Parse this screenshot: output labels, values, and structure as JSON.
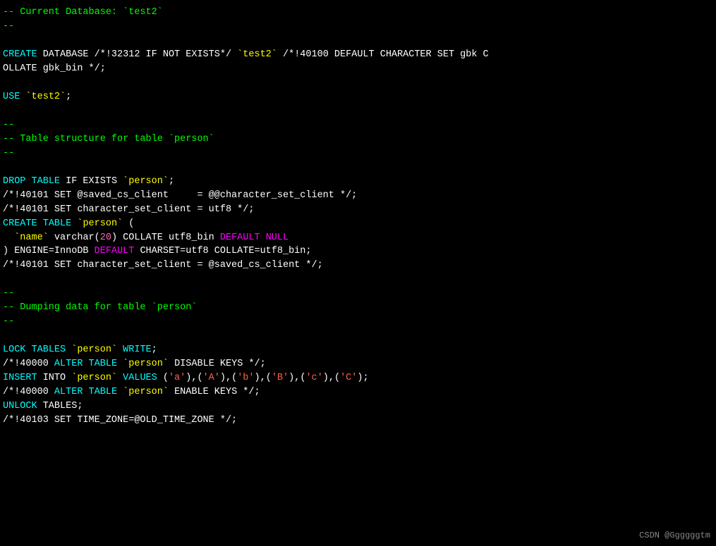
{
  "code": {
    "lines": [
      {
        "id": 1,
        "content": "-- Current Database: `test2`"
      },
      {
        "id": 2,
        "content": "--"
      },
      {
        "id": 3,
        "content": ""
      },
      {
        "id": 4,
        "content": "CREATE DATABASE /*!32312 IF NOT EXISTS*/ `test2` /*!40100 DEFAULT CHARACTER SET gbk C"
      },
      {
        "id": 5,
        "content": "OLLATE gbk_bin */;"
      },
      {
        "id": 6,
        "content": ""
      },
      {
        "id": 7,
        "content": "USE `test2`;"
      },
      {
        "id": 8,
        "content": ""
      },
      {
        "id": 9,
        "content": "--"
      },
      {
        "id": 10,
        "content": "-- Table structure for table `person`"
      },
      {
        "id": 11,
        "content": "--"
      },
      {
        "id": 12,
        "content": ""
      },
      {
        "id": 13,
        "content": "DROP TABLE IF EXISTS `person`;"
      },
      {
        "id": 14,
        "content": "/*!40101 SET @saved_cs_client     = @@character_set_client */;"
      },
      {
        "id": 15,
        "content": "/*!40101 SET character_set_client = utf8 */;"
      },
      {
        "id": 16,
        "content": "CREATE TABLE `person` ("
      },
      {
        "id": 17,
        "content": "  `name` varchar(20) COLLATE utf8_bin DEFAULT NULL"
      },
      {
        "id": 18,
        "content": ") ENGINE=InnoDB DEFAULT CHARSET=utf8 COLLATE=utf8_bin;"
      },
      {
        "id": 19,
        "content": "/*!40101 SET character_set_client = @saved_cs_client */;"
      },
      {
        "id": 20,
        "content": ""
      },
      {
        "id": 21,
        "content": "--"
      },
      {
        "id": 22,
        "content": "-- Dumping data for table `person`"
      },
      {
        "id": 23,
        "content": "--"
      },
      {
        "id": 24,
        "content": ""
      },
      {
        "id": 25,
        "content": "LOCK TABLES `person` WRITE;"
      },
      {
        "id": 26,
        "content": "/*!40000 ALTER TABLE `person` DISABLE KEYS */;"
      },
      {
        "id": 27,
        "content": "INSERT INTO `person` VALUES ('a'),('A'),('b'),('B'),('c'),('C');"
      },
      {
        "id": 28,
        "content": "/*!40000 ALTER TABLE `person` ENABLE KEYS */;"
      },
      {
        "id": 29,
        "content": "UNLOCK TABLES;"
      },
      {
        "id": 30,
        "content": "/*!40103 SET TIME_ZONE=@OLD_TIME_ZONE */;"
      }
    ]
  },
  "watermark": "CSDN @Ggggggtm"
}
